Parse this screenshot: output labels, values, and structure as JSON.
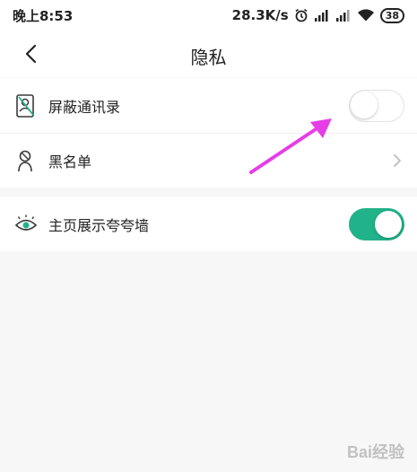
{
  "status_bar": {
    "time": "晚上8:53",
    "network_speed": "28.3K/s",
    "battery": "38",
    "icons": [
      "alarm-icon",
      "signal-hd-icon",
      "signal-icon",
      "wifi-icon",
      "battery-icon"
    ]
  },
  "nav": {
    "title": "隐私",
    "back_icon": "back-arrow-icon"
  },
  "settings": {
    "block_contacts": {
      "label": "屏蔽通讯录",
      "icon": "contacts-block-icon",
      "enabled": false
    },
    "blacklist": {
      "label": "黑名单",
      "icon": "person-block-icon"
    },
    "show_praise_wall": {
      "label": "主页展示夸夸墙",
      "icon": "eye-icon",
      "enabled": true
    }
  },
  "colors": {
    "accent": "#21b28a",
    "annotation": "#e63ee6",
    "background": "#f7f7f7"
  },
  "watermark": "Bai经验"
}
